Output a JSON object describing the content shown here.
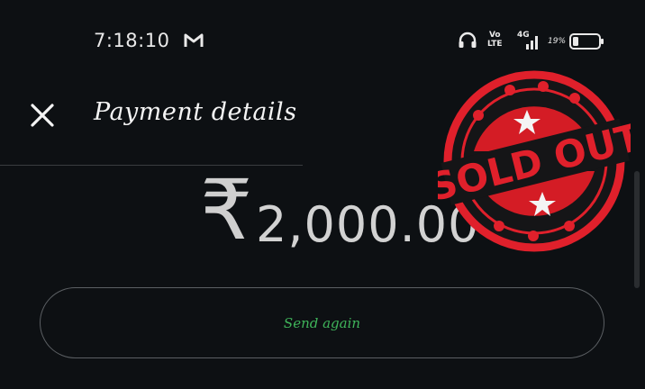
{
  "status_bar": {
    "time": "7:18:10",
    "volte_top": "Vo",
    "volte_bottom": "LTE",
    "network": "4G",
    "battery": "19%"
  },
  "header": {
    "title": "Payment details"
  },
  "payment": {
    "currency_symbol": "₹",
    "amount": "2,000.00"
  },
  "actions": {
    "send_again_label": "Send again"
  },
  "stamp": {
    "text": "SOLD OUT",
    "color": "#e0202b"
  },
  "colors": {
    "background": "#0d1013",
    "accent_green": "#3fb45a"
  }
}
